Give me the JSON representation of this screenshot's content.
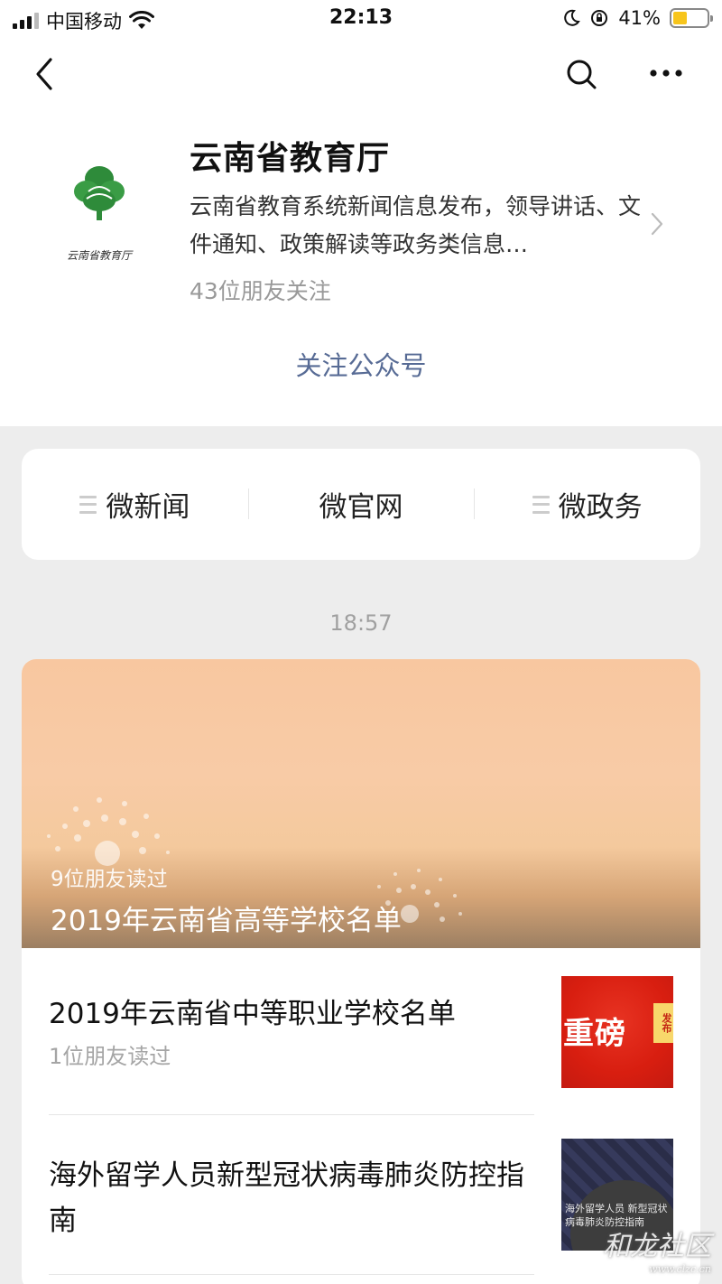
{
  "status_bar": {
    "carrier": "中国移动",
    "time": "22:13",
    "battery": "41%"
  },
  "account": {
    "name": "云南省教育厅",
    "logo_caption": "云南省教育厅",
    "description": "云南省教育系统新闻信息发布，领导讲话、文件通知、政策解读等政务类信息…",
    "friends_following": "43位朋友关注",
    "follow_label": "关注公众号"
  },
  "menu": {
    "items": [
      {
        "label": "微新闻",
        "has_submenu": true
      },
      {
        "label": "微官网",
        "has_submenu": false
      },
      {
        "label": "微政务",
        "has_submenu": true
      }
    ]
  },
  "messages": {
    "timestamp": "18:57",
    "cover_article": {
      "read_count": "9位朋友读过",
      "title": "2019年云南省高等学校名单"
    },
    "articles": [
      {
        "title": "2019年云南省中等职业学校名单",
        "read_count": "1位朋友读过",
        "thumb_text": "重磅",
        "thumb_badge": "发布"
      },
      {
        "title": "海外留学人员新型冠状病毒肺炎防控指南",
        "thumb_text": "海外留学人员 新型冠状病毒肺炎防控指南"
      }
    ]
  },
  "watermark": {
    "text": "和龙社区",
    "sub": "www.clzc.cn"
  },
  "colors": {
    "link_blue": "#576b95",
    "battery_yellow": "#f7c51c",
    "background_gray": "#ededed"
  }
}
